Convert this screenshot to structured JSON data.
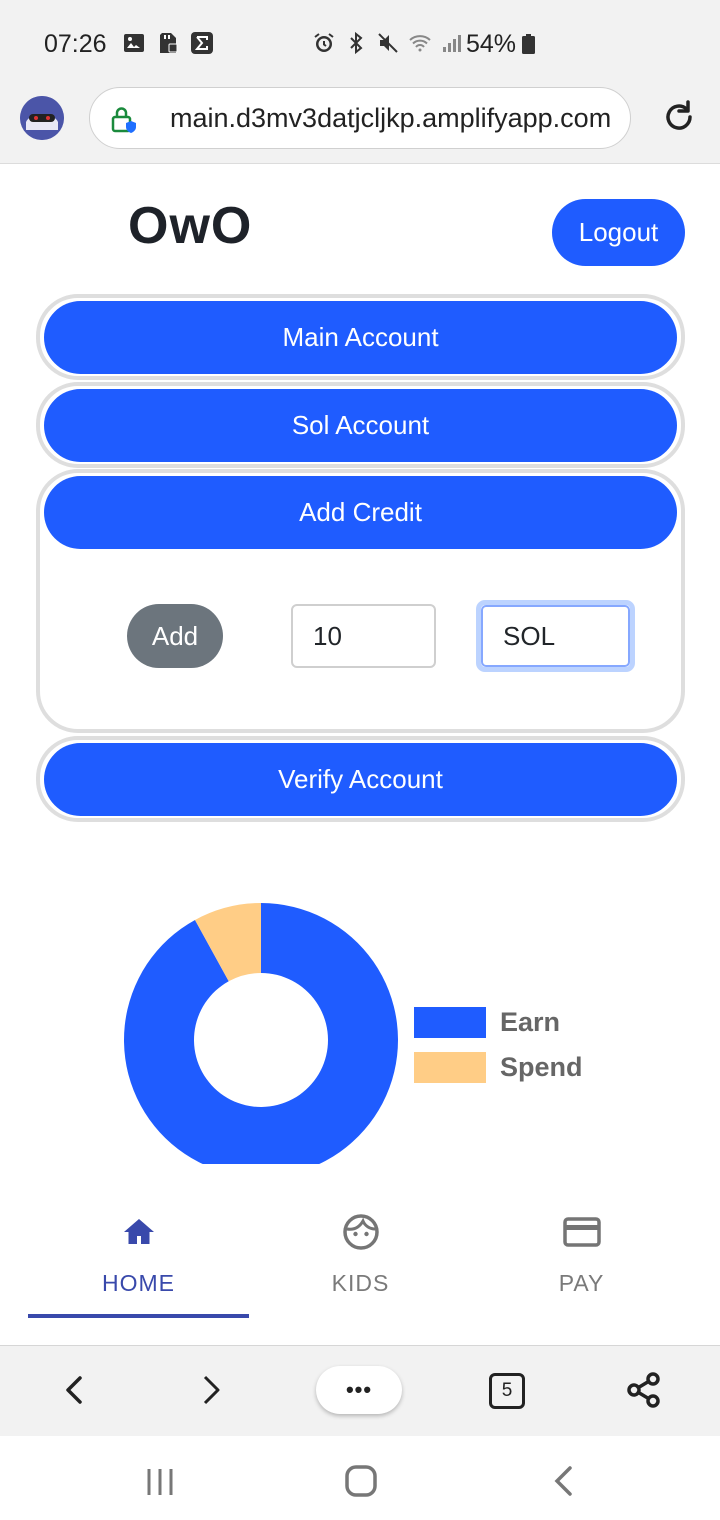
{
  "status_bar": {
    "time": "07:26",
    "battery": "54%",
    "icons": [
      "gallery-icon",
      "sd-card-icon",
      "sigma-icon",
      "alarm-icon",
      "bluetooth-icon",
      "mute-icon",
      "wifi-icon",
      "signal-icon",
      "battery-icon"
    ]
  },
  "browser": {
    "url": "main.d3mv3datjcljkp.amplifyapp.com",
    "tab_count": "5",
    "more_label": "•••"
  },
  "app": {
    "title": "OwO",
    "logout_label": "Logout"
  },
  "accordion": {
    "main_account": "Main Account",
    "sol_account": "Sol Account",
    "add_credit": "Add Credit",
    "verify_account": "Verify Account"
  },
  "add_credit_form": {
    "add_label": "Add",
    "amount_value": "10",
    "currency_value": "SOL"
  },
  "chart_data": {
    "type": "pie",
    "style": "doughnut",
    "categories": [
      "Earn",
      "Spend"
    ],
    "values": [
      92,
      8
    ],
    "colors": [
      "#1f5cff",
      "#ffcd86"
    ],
    "legend_position": "right"
  },
  "bottom_nav": {
    "items": [
      {
        "label": "HOME",
        "icon": "home-icon",
        "active": true
      },
      {
        "label": "KIDS",
        "icon": "kid-face-icon",
        "active": false
      },
      {
        "label": "PAY",
        "icon": "credit-card-icon",
        "active": false
      }
    ]
  },
  "colors": {
    "primary": "#1f5cff",
    "secondary": "#6c757d",
    "nav_active": "#3949ab"
  }
}
